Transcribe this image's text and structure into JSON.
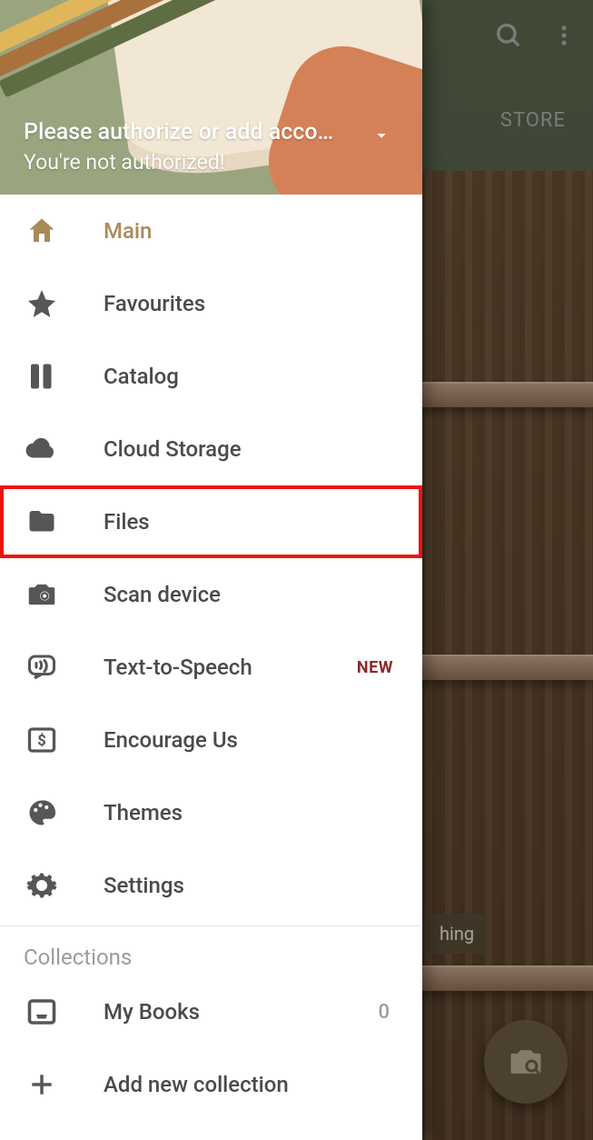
{
  "toolbar": {
    "store_label": "STORE"
  },
  "tooltip_fragment": "hing",
  "drawer": {
    "header": {
      "title": "Please authorize or add acco…",
      "subtitle": "You're not authorized!"
    },
    "items": [
      {
        "id": "main",
        "label": "Main",
        "icon": "home-icon",
        "active": true
      },
      {
        "id": "favourites",
        "label": "Favourites",
        "icon": "star-icon"
      },
      {
        "id": "catalog",
        "label": "Catalog",
        "icon": "books-icon"
      },
      {
        "id": "cloud-storage",
        "label": "Cloud Storage",
        "icon": "cloud-icon"
      },
      {
        "id": "files",
        "label": "Files",
        "icon": "folder-icon",
        "highlight": true
      },
      {
        "id": "scan-device",
        "label": "Scan device",
        "icon": "camera-search-icon"
      },
      {
        "id": "tts",
        "label": "Text-to-Speech",
        "icon": "speech-icon",
        "badge": "NEW"
      },
      {
        "id": "encourage",
        "label": "Encourage Us",
        "icon": "dollar-icon"
      },
      {
        "id": "themes",
        "label": "Themes",
        "icon": "palette-icon"
      },
      {
        "id": "settings",
        "label": "Settings",
        "icon": "gear-icon"
      }
    ],
    "collections_title": "Collections",
    "collections": [
      {
        "id": "my-books",
        "label": "My Books",
        "count": "0"
      }
    ],
    "add_collection_label": "Add new collection"
  }
}
